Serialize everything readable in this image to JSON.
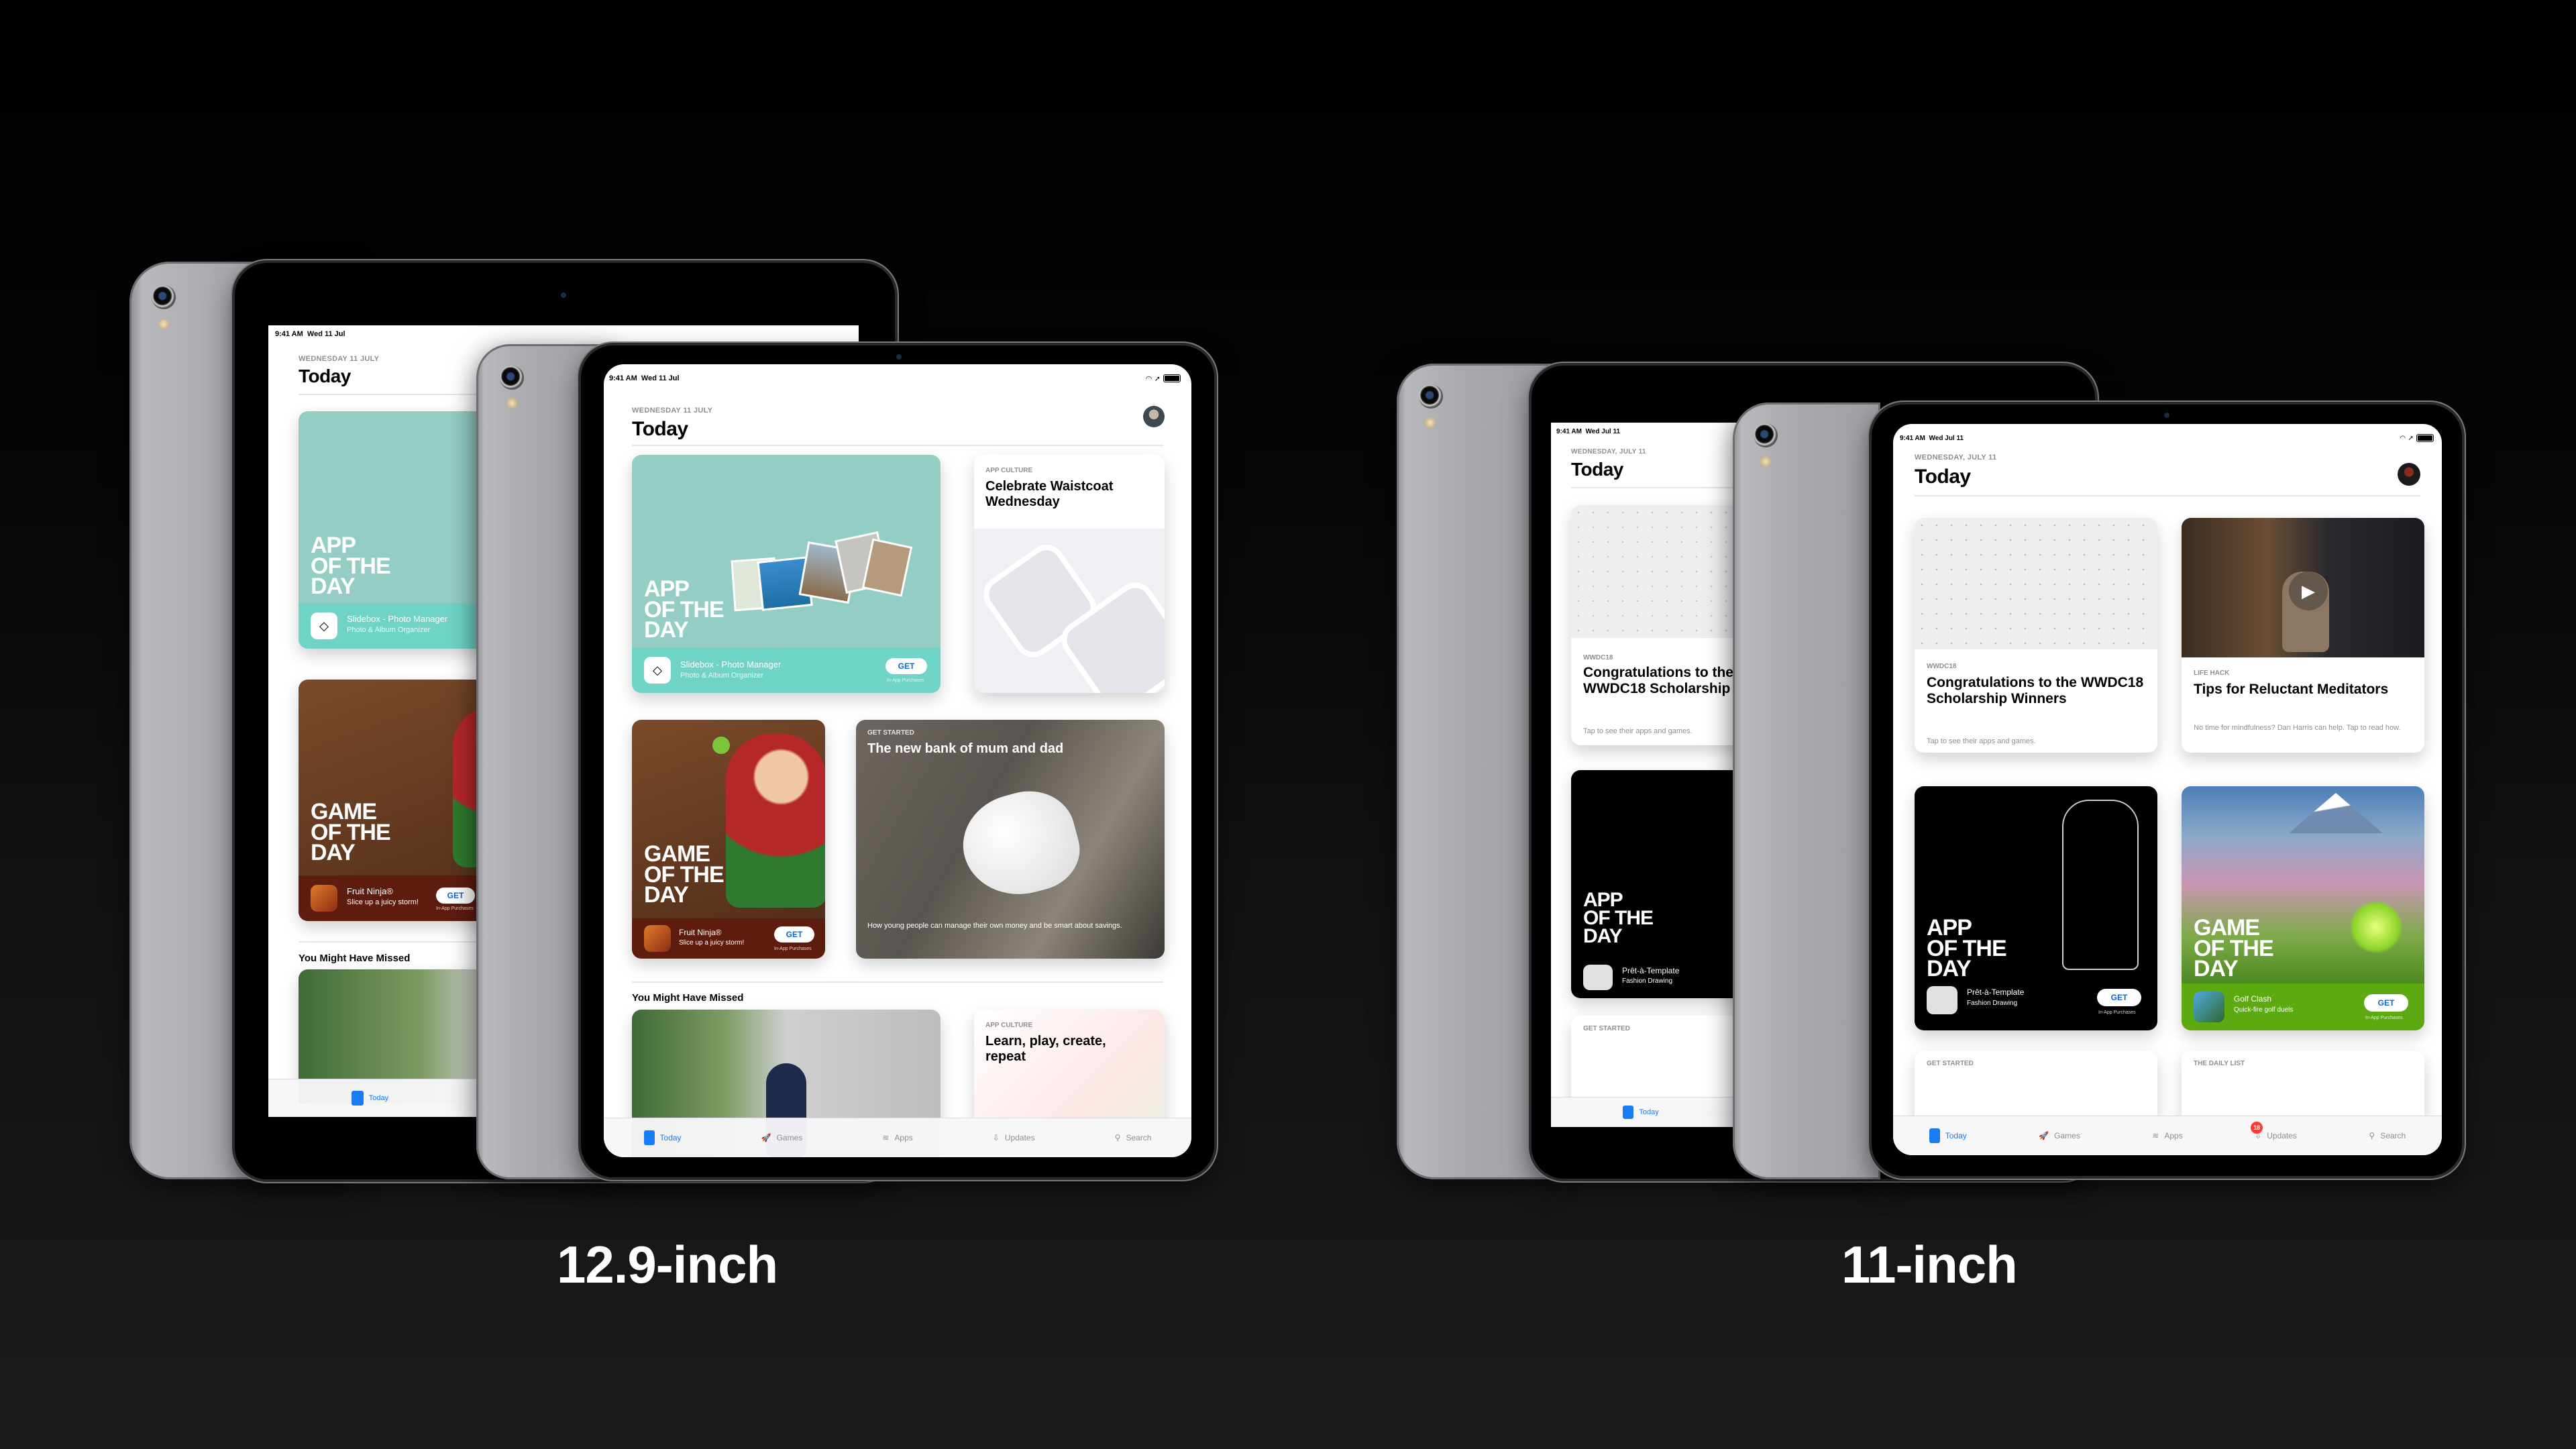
{
  "labels": {
    "large": "12.9-inch",
    "small": "11-inch"
  },
  "colors": {
    "accent_blue": "#1a7cf4",
    "get_text": "#0a68d8",
    "badge_red": "#ff3b30",
    "teal_card": "#93cdc3",
    "teal_bar": "#6fd3c6",
    "fruit_bar": "#5e1c0f",
    "golf_bar": "#5da912"
  },
  "ipad_129": {
    "status_time": "9:41 AM",
    "status_date": "Wed 11 Jul",
    "date_header": "WEDNESDAY 11 JULY",
    "title": "Today",
    "cards": {
      "app_of_day": {
        "headline": [
          "APP",
          "OF THE",
          "DAY"
        ],
        "app_name": "Slidebox - Photo Manager",
        "app_subtitle": "Photo & Album Organizer",
        "button": "GET",
        "iap": "In-App Purchases"
      },
      "culture": {
        "kicker": "APP CULTURE",
        "headline": "Celebrate Waistcoat Wednesday"
      },
      "game_of_day": {
        "headline": [
          "GAME",
          "OF THE",
          "DAY"
        ],
        "app_name": "Fruit Ninja®",
        "app_subtitle": "Slice up a juicy storm!",
        "button": "GET",
        "iap": "In-App Purchases"
      },
      "get_started": {
        "kicker": "GET STARTED",
        "headline": "The new bank of mum and dad",
        "body": "How young people can manage their own money and be smart about savings."
      },
      "learn": {
        "kicker": "APP CULTURE",
        "headline": "Learn, play, create, repeat"
      }
    },
    "section_header": "You Might Have Missed",
    "tabs": [
      {
        "label": "Today",
        "icon": "today-icon",
        "active": true
      },
      {
        "label": "Games",
        "icon": "rocket-icon",
        "active": false
      },
      {
        "label": "Apps",
        "icon": "layers-icon",
        "active": false
      },
      {
        "label": "Updates",
        "icon": "download-icon",
        "active": false
      },
      {
        "label": "Search",
        "icon": "search-icon",
        "active": false
      }
    ]
  },
  "ipad_11": {
    "status_time": "9:41 AM",
    "status_date": "Wed Jul 11",
    "date_header": "WEDNESDAY, JULY 11",
    "title": "Today",
    "cards": {
      "wwdc": {
        "kicker": "WWDC18",
        "headline": "Congratulations to the WWDC18 Scholarship Winners",
        "body": "Tap to see their apps and games."
      },
      "lifehack": {
        "kicker": "LIFE HACK",
        "headline": "Tips for Reluctant Meditators",
        "body": "No time for mindfulness? Dan Harris can help. Tap to read how."
      },
      "app_of_day": {
        "headline": [
          "APP",
          "OF THE",
          "DAY"
        ],
        "app_name": "Prêt-à-Template",
        "app_subtitle": "Fashion Drawing",
        "button": "GET",
        "iap": "In-App Purchases"
      },
      "game_of_day": {
        "headline": [
          "GAME",
          "OF THE",
          "DAY"
        ],
        "app_name": "Golf Clash",
        "app_subtitle": "Quick-fire golf duels",
        "button": "GET",
        "iap": "In-App Purchases"
      },
      "get_started": {
        "kicker": "GET STARTED"
      },
      "daily_list": {
        "kicker": "THE DAILY LIST"
      }
    },
    "updates_badge": "18",
    "tabs": [
      {
        "label": "Today",
        "icon": "today-icon",
        "active": true
      },
      {
        "label": "Games",
        "icon": "rocket-icon",
        "active": false
      },
      {
        "label": "Apps",
        "icon": "layers-icon",
        "active": false
      },
      {
        "label": "Updates",
        "icon": "download-icon",
        "active": false
      },
      {
        "label": "Search",
        "icon": "search-icon",
        "active": false
      }
    ]
  }
}
